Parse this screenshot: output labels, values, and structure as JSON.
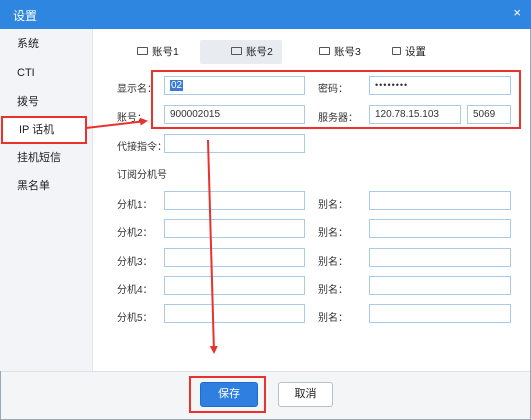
{
  "window": {
    "title": "设置",
    "close_glyph": "×"
  },
  "sidebar": {
    "items": [
      {
        "label": "系统"
      },
      {
        "label": "CTI"
      },
      {
        "label": "拨号"
      },
      {
        "label": "IP 话机",
        "active": true
      },
      {
        "label": "挂机短信"
      },
      {
        "label": "黑名单"
      }
    ]
  },
  "tabs": [
    {
      "label": "账号1",
      "icon": "id-card-icon"
    },
    {
      "label": "账号2",
      "icon": "id-card-icon",
      "active": true
    },
    {
      "label": "账号3",
      "icon": "id-card-icon"
    },
    {
      "label": "设置",
      "icon": "lock-key-icon"
    }
  ],
  "form": {
    "display_name_label": "显示名：",
    "display_name_value": "02",
    "password_label": "密码：",
    "password_value": "••••••••",
    "account_label": "账号：",
    "account_value": "900002015",
    "server_label": "服务器：",
    "server_value": "120.78.15.103",
    "port_value": "5069",
    "proxy_label": "代接指令：",
    "proxy_value": "",
    "subscribe_title": "订阅分机号",
    "extensions": [
      {
        "ext_label": "分机1：",
        "alias_label": "别名："
      },
      {
        "ext_label": "分机2：",
        "alias_label": "别名："
      },
      {
        "ext_label": "分机3：",
        "alias_label": "别名："
      },
      {
        "ext_label": "分机4：",
        "alias_label": "别名："
      },
      {
        "ext_label": "分机5：",
        "alias_label": "别名："
      }
    ]
  },
  "buttons": {
    "save_label": "保存",
    "cancel_label": "取消"
  },
  "colors": {
    "titlebar": "#2e86e0",
    "highlight": "#e8322b",
    "save_button": "#2f7fe0"
  }
}
